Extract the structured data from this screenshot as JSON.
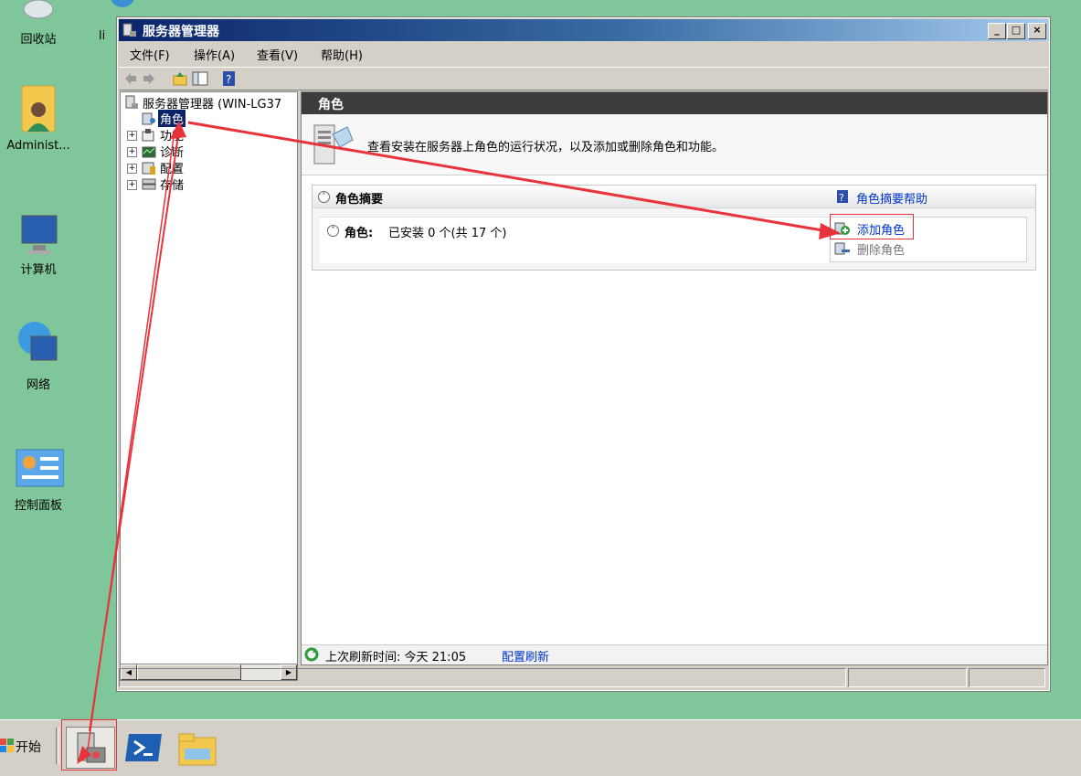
{
  "desktop": {
    "icons": [
      {
        "label": "回收站"
      },
      {
        "label": "li"
      },
      {
        "label": "Administ..."
      },
      {
        "label": "计算机"
      },
      {
        "label": "网络"
      },
      {
        "label": "控制面板"
      }
    ]
  },
  "window": {
    "title": "服务器管理器",
    "buttons": {
      "minimize": "_",
      "maximize": "□",
      "close": "×"
    },
    "menu": [
      "文件(F)",
      "操作(A)",
      "查看(V)",
      "帮助(H)"
    ]
  },
  "tree": {
    "root": "服务器管理器 (WIN-LG37",
    "items": [
      {
        "label": "角色",
        "selected": true
      },
      {
        "label": "功能"
      },
      {
        "label": "诊断"
      },
      {
        "label": "配置"
      },
      {
        "label": "存储"
      }
    ]
  },
  "content": {
    "header": "角色",
    "description": "查看安装在服务器上角色的运行状况，以及添加或删除角色和功能。",
    "section_title": "角色摘要",
    "help_link": "角色摘要帮助",
    "roles_label": "角色:",
    "roles_status": "已安装 0 个(共 17 个)",
    "add_role": "添加角色",
    "remove_role": "删除角色",
    "last_refresh_label": "上次刷新时间: 今天 21:05",
    "config_refresh": "配置刷新"
  },
  "taskbar": {
    "start_label": "开始"
  },
  "colors": {
    "desktop": "#7fc79a",
    "accent_link": "#0033cc",
    "annotation": "#e8333a"
  }
}
